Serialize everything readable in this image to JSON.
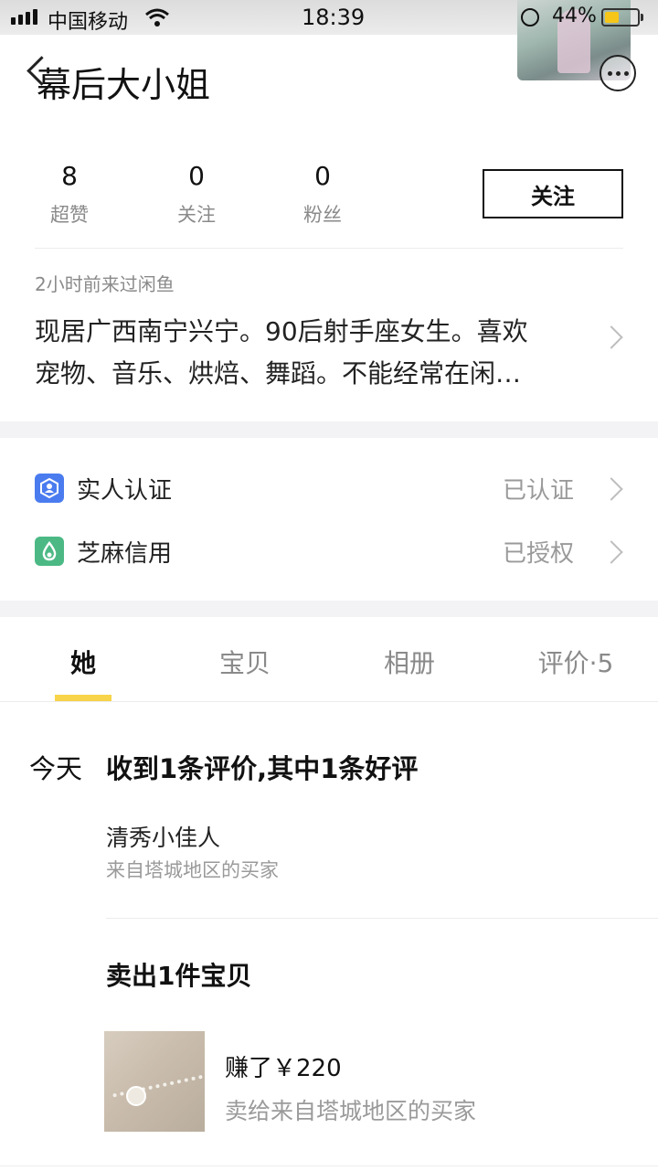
{
  "status_bar": {
    "carrier": "中国移动",
    "time": "18:39",
    "battery": "44%",
    "battery_level": 0.44
  },
  "header": {
    "title": "幕后大小姐"
  },
  "stats": [
    {
      "value": "8",
      "label": "超赞"
    },
    {
      "value": "0",
      "label": "关注"
    },
    {
      "value": "0",
      "label": "粉丝"
    }
  ],
  "follow_label": "关注",
  "profile": {
    "last_seen": "2小时前来过闲鱼",
    "bio_line1": "现居广西南宁兴宁。90后射手座女生。喜欢",
    "bio_line2": "宠物、音乐、烘焙、舞蹈。不能经常在闲…"
  },
  "verifications": [
    {
      "label": "实人认证",
      "status": "已认证",
      "icon": "person-id-icon",
      "color": "#4a7cf0"
    },
    {
      "label": "芝麻信用",
      "status": "已授权",
      "icon": "sesame-drop-icon",
      "color": "#4cb985"
    }
  ],
  "tabs": [
    {
      "label": "她",
      "active": true
    },
    {
      "label": "宝贝",
      "active": false
    },
    {
      "label": "相册",
      "active": false
    },
    {
      "label": "评价·5",
      "active": false
    }
  ],
  "feed": {
    "date": "今天",
    "summary": "收到1条评价,其中1条好评",
    "reviewer": "清秀小佳人",
    "reviewer_sub": "来自塔城地区的买家",
    "sold_title": "卖出1件宝贝",
    "earned": "赚了￥220",
    "sold_to": "卖给来自塔城地区的买家"
  },
  "colors": {
    "accent": "#f7d449",
    "divider_band": "#f3f3f5"
  }
}
